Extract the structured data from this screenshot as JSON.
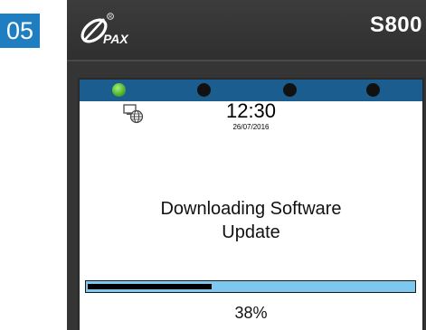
{
  "step_number": "05",
  "device": {
    "model": "S800",
    "screen": {
      "led_states": [
        true,
        false,
        false,
        false
      ],
      "clock_time": "12:30",
      "clock_date": "26/07/2016",
      "message_line1": "Downloading Software",
      "message_line2": "Update",
      "progress_fraction": 0.38,
      "progress_text": "38%"
    }
  },
  "colors": {
    "badge": "#1f7ec2",
    "led_bar": "#1b5d8f",
    "progress_track": "#7cc8ee"
  },
  "icons": [
    "pax-logo",
    "network-icon"
  ]
}
